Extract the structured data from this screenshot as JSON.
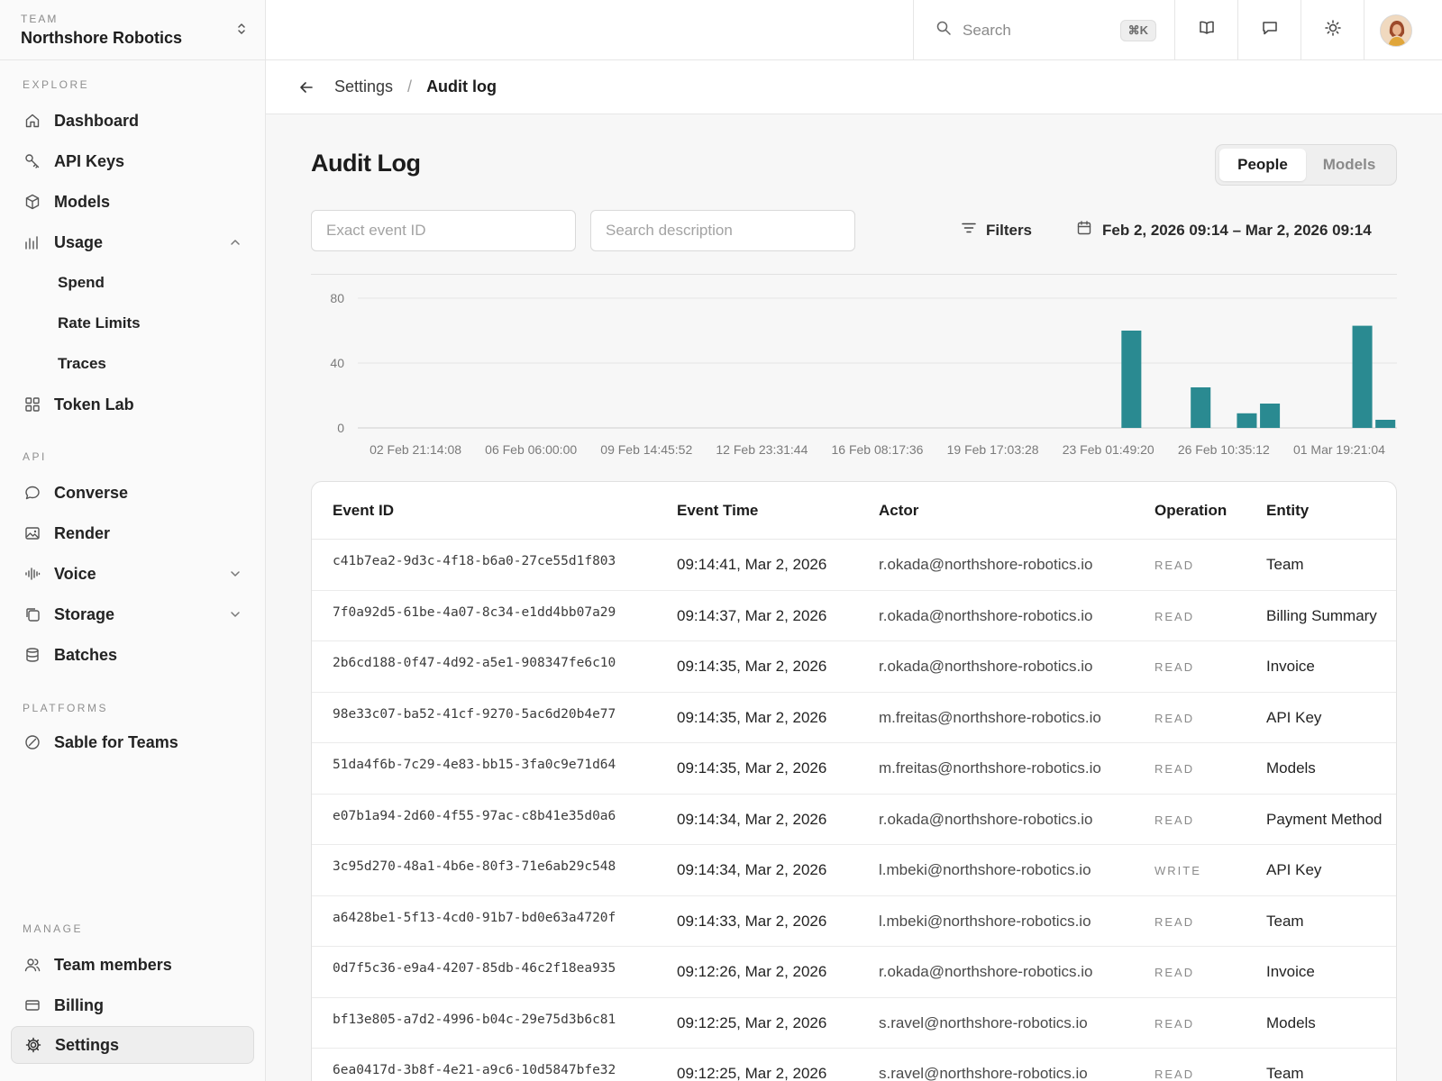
{
  "team": {
    "label": "TEAM",
    "name": "Northshore Robotics"
  },
  "sidebar": {
    "explore_label": "EXPLORE",
    "api_label": "API",
    "platforms_label": "PLATFORMS",
    "manage_label": "MANAGE",
    "items": {
      "dashboard": "Dashboard",
      "api_keys": "API Keys",
      "models": "Models",
      "usage": "Usage",
      "spend": "Spend",
      "rate_limits": "Rate Limits",
      "traces": "Traces",
      "token_lab": "Token Lab",
      "converse": "Converse",
      "render": "Render",
      "voice": "Voice",
      "storage": "Storage",
      "batches": "Batches",
      "sable_for_teams": "Sable for Teams",
      "team_members": "Team members",
      "billing": "Billing",
      "settings": "Settings"
    }
  },
  "topbar": {
    "search_placeholder": "Search",
    "shortcut": "⌘K"
  },
  "breadcrumb": {
    "parent": "Settings",
    "separator": "/",
    "current": "Audit log"
  },
  "main": {
    "title": "Audit Log",
    "segments": [
      "People",
      "Models"
    ],
    "active_segment": "People",
    "event_id_placeholder": "Exact event ID",
    "description_placeholder": "Search description",
    "filters_label": "Filters",
    "date_range": "Feb 2, 2026 09:14 – Mar 2, 2026 09:14"
  },
  "chart_data": {
    "type": "bar",
    "y_ticks": [
      0,
      40,
      80
    ],
    "ylim": [
      0,
      80
    ],
    "grid": true,
    "bar_color": "#2a8a91",
    "x_tick_labels": [
      "02 Feb 21:14:08",
      "06 Feb 06:00:00",
      "09 Feb 14:45:52",
      "12 Feb 23:31:44",
      "16 Feb 08:17:36",
      "19 Feb 17:03:28",
      "23 Feb 01:49:20",
      "26 Feb 10:35:12",
      "01 Mar 19:21:04"
    ],
    "bins": 44,
    "values": [
      0,
      0,
      0,
      0,
      0,
      0,
      0,
      0,
      0,
      0,
      0,
      0,
      0,
      0,
      0,
      0,
      0,
      0,
      0,
      0,
      0,
      0,
      0,
      0,
      0,
      0,
      0,
      0,
      0,
      0,
      0,
      0,
      0,
      60,
      0,
      0,
      25,
      0,
      9,
      15,
      0,
      0,
      0,
      63,
      5
    ]
  },
  "table": {
    "columns": [
      "Event ID",
      "Event Time",
      "Actor",
      "Operation",
      "Entity"
    ],
    "rows": [
      {
        "id": "c41b7ea2-9d3c-4f18-b6a0-27ce55d1f803",
        "time": "09:14:41, Mar 2, 2026",
        "actor": "r.okada@northshore-robotics.io",
        "op": "READ",
        "entity": "Team"
      },
      {
        "id": "7f0a92d5-61be-4a07-8c34-e1dd4bb07a29",
        "time": "09:14:37, Mar 2, 2026",
        "actor": "r.okada@northshore-robotics.io",
        "op": "READ",
        "entity": "Billing Summary"
      },
      {
        "id": "2b6cd188-0f47-4d92-a5e1-908347fe6c10",
        "time": "09:14:35, Mar 2, 2026",
        "actor": "r.okada@northshore-robotics.io",
        "op": "READ",
        "entity": "Invoice"
      },
      {
        "id": "98e33c07-ba52-41cf-9270-5ac6d20b4e77",
        "time": "09:14:35, Mar 2, 2026",
        "actor": "m.freitas@northshore-robotics.io",
        "op": "READ",
        "entity": "API Key"
      },
      {
        "id": "51da4f6b-7c29-4e83-bb15-3fa0c9e71d64",
        "time": "09:14:35, Mar 2, 2026",
        "actor": "m.freitas@northshore-robotics.io",
        "op": "READ",
        "entity": "Models"
      },
      {
        "id": "e07b1a94-2d60-4f55-97ac-c8b41e35d0a6",
        "time": "09:14:34, Mar 2, 2026",
        "actor": "r.okada@northshore-robotics.io",
        "op": "READ",
        "entity": "Payment Method"
      },
      {
        "id": "3c95d270-48a1-4b6e-80f3-71e6ab29c548",
        "time": "09:14:34, Mar 2, 2026",
        "actor": "l.mbeki@northshore-robotics.io",
        "op": "WRITE",
        "entity": "API Key"
      },
      {
        "id": "a6428be1-5f13-4cd0-91b7-bd0e63a4720f",
        "time": "09:14:33, Mar 2, 2026",
        "actor": "l.mbeki@northshore-robotics.io",
        "op": "READ",
        "entity": "Team"
      },
      {
        "id": "0d7f5c36-e9a4-4207-85db-46c2f18ea935",
        "time": "09:12:26, Mar 2, 2026",
        "actor": "r.okada@northshore-robotics.io",
        "op": "READ",
        "entity": "Invoice"
      },
      {
        "id": "bf13e805-a7d2-4996-b04c-29e75d3b6c81",
        "time": "09:12:25, Mar 2, 2026",
        "actor": "s.ravel@northshore-robotics.io",
        "op": "READ",
        "entity": "Models"
      },
      {
        "id": "6ea0417d-3b8f-4e21-a9c6-10d5847bfe32",
        "time": "09:12:25, Mar 2, 2026",
        "actor": "s.ravel@northshore-robotics.io",
        "op": "READ",
        "entity": "Team"
      }
    ]
  }
}
